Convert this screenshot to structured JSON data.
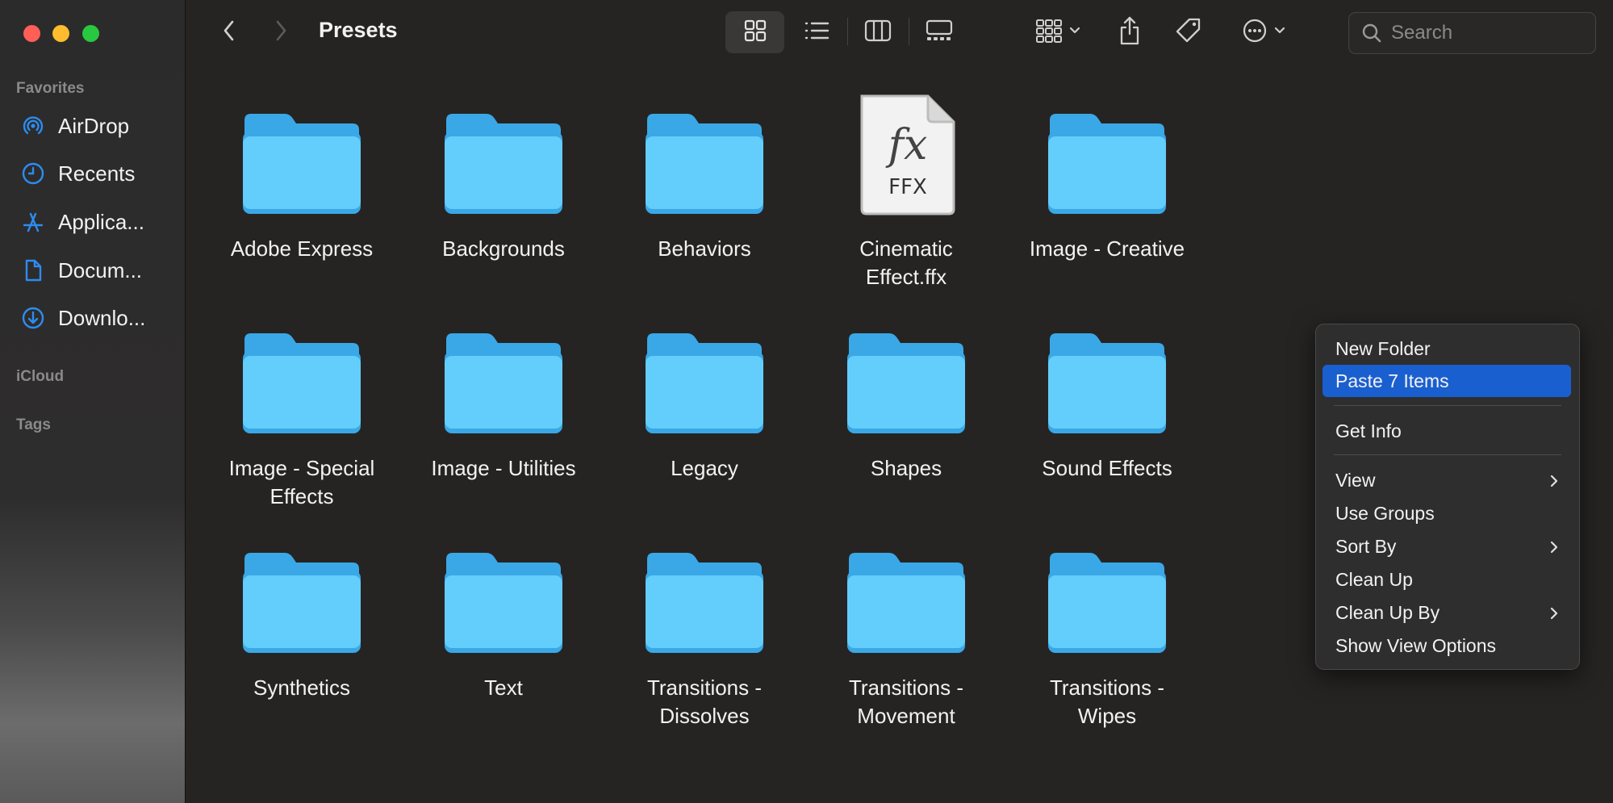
{
  "window": {
    "title": "Presets"
  },
  "sidebar": {
    "favorites_label": "Favorites",
    "items": [
      {
        "label": "AirDrop",
        "icon": "airdrop-icon"
      },
      {
        "label": "Recents",
        "icon": "clock-icon"
      },
      {
        "label": "Applica...",
        "icon": "applications-icon"
      },
      {
        "label": "Docum...",
        "icon": "document-icon"
      },
      {
        "label": "Downlo...",
        "icon": "download-icon"
      }
    ],
    "icloud_label": "iCloud",
    "tags_label": "Tags"
  },
  "toolbar": {
    "back_icon": "chevron-left-icon",
    "forward_icon": "chevron-right-icon",
    "view_modes": [
      "icon-view-icon",
      "list-view-icon",
      "column-view-icon",
      "gallery-view-icon"
    ],
    "active_view": "icon-view-icon",
    "actions": [
      "group-icon",
      "share-icon",
      "tag-icon",
      "more-icon"
    ],
    "search_placeholder": "Search"
  },
  "files": [
    {
      "name": "Adobe Express",
      "type": "folder"
    },
    {
      "name": "Backgrounds",
      "type": "folder"
    },
    {
      "name": "Behaviors",
      "type": "folder"
    },
    {
      "name": "Cinematic Effect.ffx",
      "type": "ffx",
      "badge_symbol": "fx",
      "badge_text": "FFX"
    },
    {
      "name": "Image - Creative",
      "type": "folder"
    },
    {
      "name": "Image - Special Effects",
      "type": "folder"
    },
    {
      "name": "Image - Utilities",
      "type": "folder"
    },
    {
      "name": "Legacy",
      "type": "folder"
    },
    {
      "name": "Shapes",
      "type": "folder"
    },
    {
      "name": "Sound Effects",
      "type": "folder"
    },
    {
      "name": "Synthetics",
      "type": "folder"
    },
    {
      "name": "Text",
      "type": "folder"
    },
    {
      "name": "Transitions - Dissolves",
      "type": "folder"
    },
    {
      "name": "Transitions - Movement",
      "type": "folder"
    },
    {
      "name": "Transitions - Wipes",
      "type": "folder"
    }
  ],
  "context_menu": {
    "items": [
      {
        "label": "New Folder"
      },
      {
        "label": "Paste 7 Items",
        "selected": true
      },
      {
        "label": "Get Info"
      },
      {
        "label": "View",
        "submenu": true
      },
      {
        "label": "Use Groups"
      },
      {
        "label": "Sort By",
        "submenu": true
      },
      {
        "label": "Clean Up"
      },
      {
        "label": "Clean Up By",
        "submenu": true
      },
      {
        "label": "Show View Options"
      }
    ]
  },
  "colors": {
    "folder_light": "#63cdfb",
    "folder_dark": "#3aa8e6",
    "accent": "#1a5fd0",
    "sidebar_icon": "#2d8cf0"
  }
}
